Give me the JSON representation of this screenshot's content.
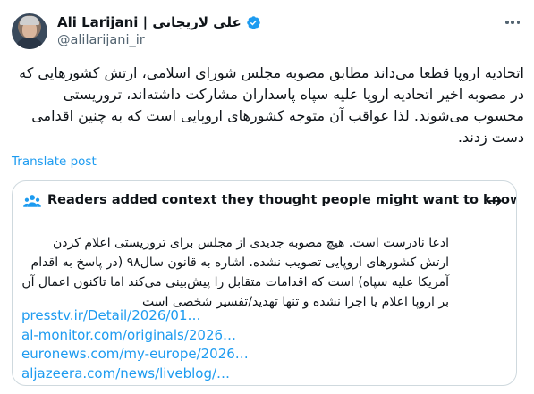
{
  "author": {
    "display_name": "Ali Larijani | علی لاریجانی",
    "handle": "@alilarijani_ir",
    "avatar_icon": "profile-photo",
    "verified_icon": "verified-badge-icon",
    "more_icon": "more-options-icon"
  },
  "tweet": {
    "text": "اتحادیه اروپا قطعا می‌داند مطابق مصوبه مجلس شورای اسلامی، ارتش کشورهایی که در مصوبه اخیر اتحادیه اروپا علیه سپاه پاسداران مشارکت داشته‌اند، تروریستی محسوب می‌شوند. لذا عواقب آن متوجه کشورهای اروپایی است که به چنین اقدامی دست زدند.",
    "translate_label": "Translate post"
  },
  "community_note": {
    "header": "Readers added context they thought people might want to know",
    "header_icon": "people-icon",
    "arrow_icon": "arrow-right-icon",
    "text": "ادعا نادرست است. هیچ مصوبه جدیدی از مجلس برای تروریستی اعلام کردن ارتش کشورهای اروپایی تصویب نشده. اشاره به قانون سال۹۸ (در پاسخ به اقدام آمریکا علیه سپاه) است که اقدامات متقابل را پیش‌بینی می‌کند اما تاکنون اعمال آن بر اروپا اعلام یا اجرا نشده و تنها تهدید/تفسیر شخصی است",
    "links": [
      "presstv.ir/Detail/2026/01…",
      "al-monitor.com/originals/2026…",
      "euronews.com/my-europe/2026…",
      "aljazeera.com/news/liveblog/…"
    ]
  },
  "colors": {
    "link": "#1d9bf0",
    "text": "#0f1419",
    "secondary": "#536471",
    "border": "#cfd9de"
  }
}
